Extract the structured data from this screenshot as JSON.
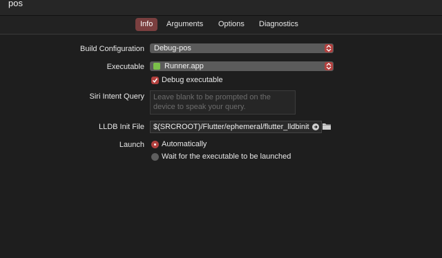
{
  "window": {
    "title": "pos"
  },
  "tabs": [
    {
      "label": "Info",
      "active": true
    },
    {
      "label": "Arguments",
      "active": false
    },
    {
      "label": "Options",
      "active": false
    },
    {
      "label": "Diagnostics",
      "active": false
    }
  ],
  "form": {
    "build_configuration": {
      "label": "Build Configuration",
      "value": "Debug-pos"
    },
    "executable": {
      "label": "Executable",
      "value": "Runner.app",
      "icon": "app-icon"
    },
    "debug_executable": {
      "label": "Debug executable",
      "checked": true
    },
    "siri_intent": {
      "label": "Siri Intent Query",
      "placeholder": "Leave blank to be prompted on the device to speak your query."
    },
    "lldb_init": {
      "label": "LLDB Init File",
      "value": "$(SRCROOT)/Flutter/ephemeral/flutter_lldbinit"
    },
    "launch": {
      "label": "Launch",
      "options": [
        {
          "label": "Automatically",
          "selected": true
        },
        {
          "label": "Wait for the executable to be launched",
          "selected": false
        }
      ]
    }
  },
  "colors": {
    "accent": "#b2403e",
    "active_tab": "#7a3f3f",
    "background": "#1e1e1e"
  }
}
